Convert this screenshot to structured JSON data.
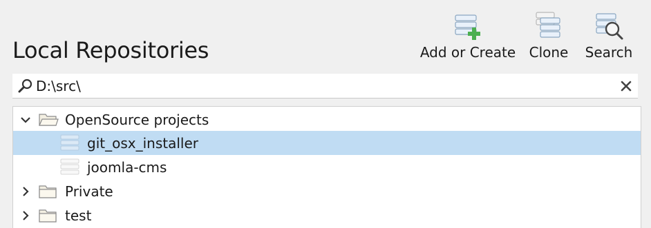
{
  "header": {
    "title": "Local Repositories"
  },
  "toolbar": {
    "add_label": "Add or Create",
    "clone_label": "Clone",
    "search_label": "Search"
  },
  "filter": {
    "value": "D:\\src\\",
    "placeholder": ""
  },
  "tree": {
    "items": [
      {
        "label": "OpenSource projects",
        "type": "folder",
        "expanded": true,
        "level": 0
      },
      {
        "label": "git_osx_installer",
        "type": "repository",
        "selected": true,
        "level": 1
      },
      {
        "label": "joomla-cms",
        "type": "repository",
        "level": 1
      },
      {
        "label": "Private",
        "type": "folder",
        "expanded": false,
        "level": 0
      },
      {
        "label": "test",
        "type": "folder",
        "expanded": false,
        "level": 0
      }
    ]
  },
  "colors": {
    "background": "#f0f0f0",
    "selection": "#c0dcf3",
    "add_plus": "#4caf50",
    "repo_icon": "#dbe9f6"
  },
  "icons": {
    "add": "add-repository-icon",
    "clone": "clone-icon",
    "search": "search-icon",
    "filter": "magnifier-icon",
    "clear": "clear-icon",
    "folder": "folder-icon",
    "repository": "repository-icon"
  }
}
